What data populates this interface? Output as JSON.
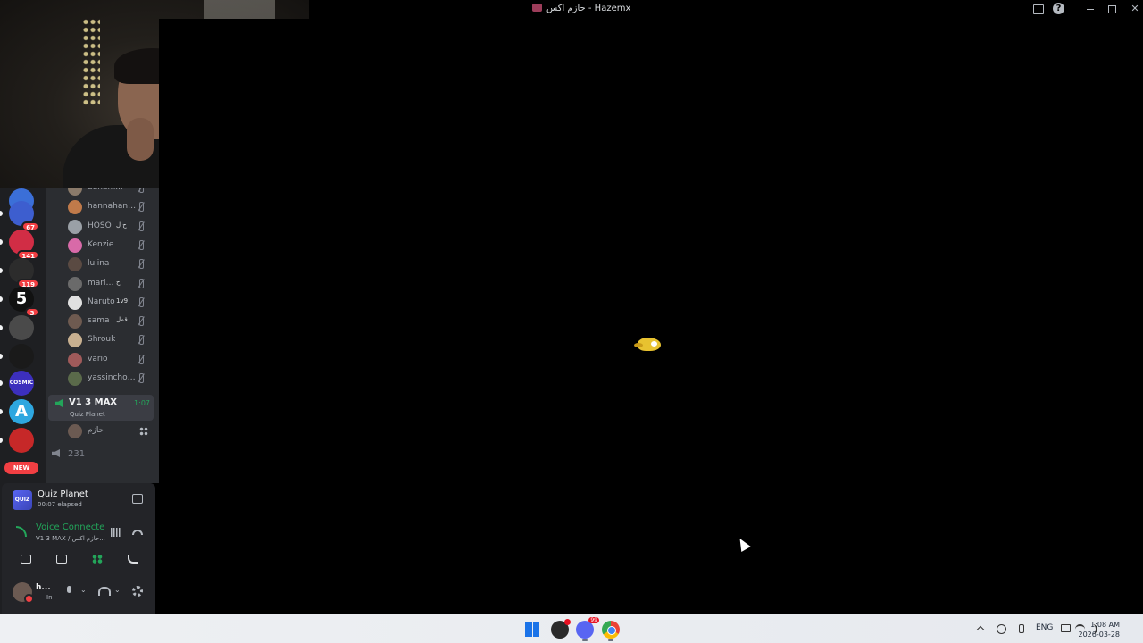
{
  "window": {
    "title": "حازم اكس - Hazemx"
  },
  "servers": [
    {
      "name": "server-1",
      "color": "#3b6fd8",
      "badge": "",
      "pill": false
    },
    {
      "name": "server-gaming",
      "color": "#3d5ecf",
      "badge": "67",
      "pill": true
    },
    {
      "name": "server-arabic",
      "color": "#d12d45",
      "badge": "141",
      "pill": true
    },
    {
      "name": "server-dark",
      "color": "#2c2c2c",
      "badge": "119",
      "pill": true
    },
    {
      "name": "server-5",
      "color": "#111111",
      "badge": "3",
      "pill": true,
      "letter": "5"
    },
    {
      "name": "server-skull",
      "color": "#4a4a4a",
      "badge": "",
      "pill": true
    },
    {
      "name": "server-mask",
      "color": "#1a1a1a",
      "badge": "",
      "pill": true
    },
    {
      "name": "server-cosmic",
      "color": "#3c2fbd",
      "badge": "",
      "pill": true,
      "letter": "COSMIC"
    },
    {
      "name": "server-a",
      "color": "#2ea7e0",
      "badge": "",
      "pill": true,
      "letter": "A"
    },
    {
      "name": "server-red",
      "color": "#c62828",
      "badge": "",
      "pill": true
    }
  ],
  "rail": {
    "new_label": "NEW"
  },
  "members": [
    {
      "name": "adham...",
      "color": "#8a7a6a",
      "extra": ""
    },
    {
      "name": "hannahann...",
      "color": "#c07a4a",
      "extra": ""
    },
    {
      "name": "HOSO",
      "color": "#9aa0a6",
      "extra": "ح ل"
    },
    {
      "name": "Kenzie",
      "color": "#d86aa8",
      "extra": ""
    },
    {
      "name": "lulina",
      "color": "#5a4a42",
      "extra": ""
    },
    {
      "name": "mariam",
      "color": "#6a6a6a",
      "extra": "ح"
    },
    {
      "name": "Naruto",
      "color": "#e0e0e0",
      "extra": "1v9"
    },
    {
      "name": "sama",
      "color": "#6e5a50",
      "extra": "قمل"
    },
    {
      "name": "Shrouk",
      "color": "#c8b090",
      "extra": ""
    },
    {
      "name": "vario",
      "color": "#a05a5a",
      "extra": ""
    },
    {
      "name": "yassinchop...",
      "color": "#5a6a4a",
      "extra": ""
    }
  ],
  "voice_channel": {
    "name": "V1 3 MAX",
    "activity": "Quiz Planet",
    "time": "1:07",
    "member": "حازم"
  },
  "other_channel": {
    "name": "231"
  },
  "panel": {
    "activity_icon_label": "QUIZ",
    "activity_name": "Quiz Planet",
    "activity_elapsed": "00:07 elapsed",
    "voice_label": "Voice Connecte",
    "voice_channel": "V1 3 MAX / حازم اكس...",
    "user_name": "h...",
    "user_status": "In"
  },
  "taskbar": {
    "lang": "ENG",
    "time": "1:08 AM",
    "date": "2026-03-28",
    "discord_badge": "99"
  }
}
